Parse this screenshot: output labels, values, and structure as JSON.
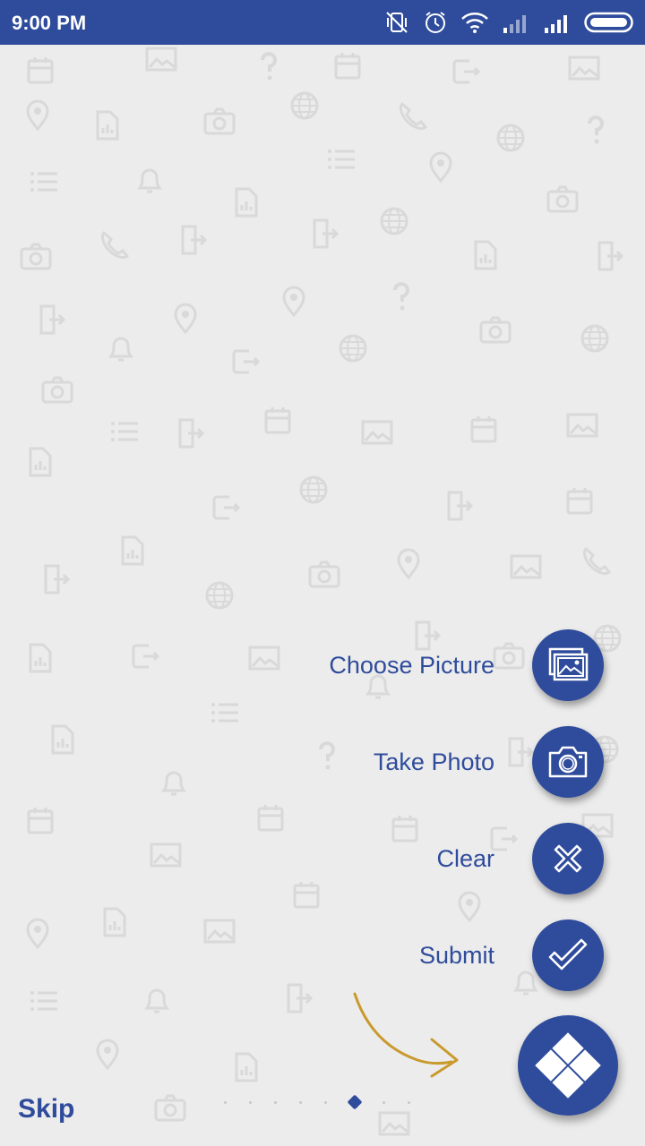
{
  "status_bar": {
    "time": "9:00 PM"
  },
  "fab_menu": {
    "choose_picture": "Choose Picture",
    "take_photo": "Take Photo",
    "clear": "Clear",
    "submit": "Submit"
  },
  "footer": {
    "skip": "Skip",
    "pager": {
      "page_count": 8,
      "active_page": 6
    }
  },
  "colors": {
    "primary": "#2f4c9c",
    "background": "#ececec",
    "accent": "#c99a2e"
  }
}
